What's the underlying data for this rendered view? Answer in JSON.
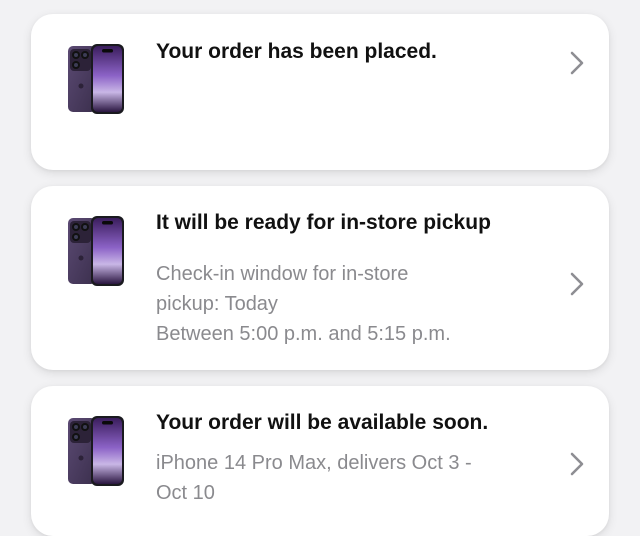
{
  "colors": {
    "background": "#f2f2f4",
    "card": "#ffffff",
    "title_text": "#111111",
    "detail_text": "#8a8a8e",
    "chevron": "#8e8e93",
    "phone_accent": "#6a3f9e"
  },
  "cards": [
    {
      "icon": "iphone-14-pro-deep-purple",
      "title": "Your order has been placed.",
      "details": []
    },
    {
      "icon": "iphone-14-pro-deep-purple",
      "title": "It will be ready for in-store pickup",
      "details": [
        "Check-in window for in-store",
        "pickup: Today",
        "Between 5:00 p.m. and 5:15 p.m."
      ]
    },
    {
      "icon": "iphone-14-pro-deep-purple",
      "title": "Your order will be available soon.",
      "details": [
        "iPhone 14 Pro Max, delivers Oct 3 -",
        "Oct 10"
      ]
    }
  ],
  "chevron_icon": "chevron-right-icon"
}
